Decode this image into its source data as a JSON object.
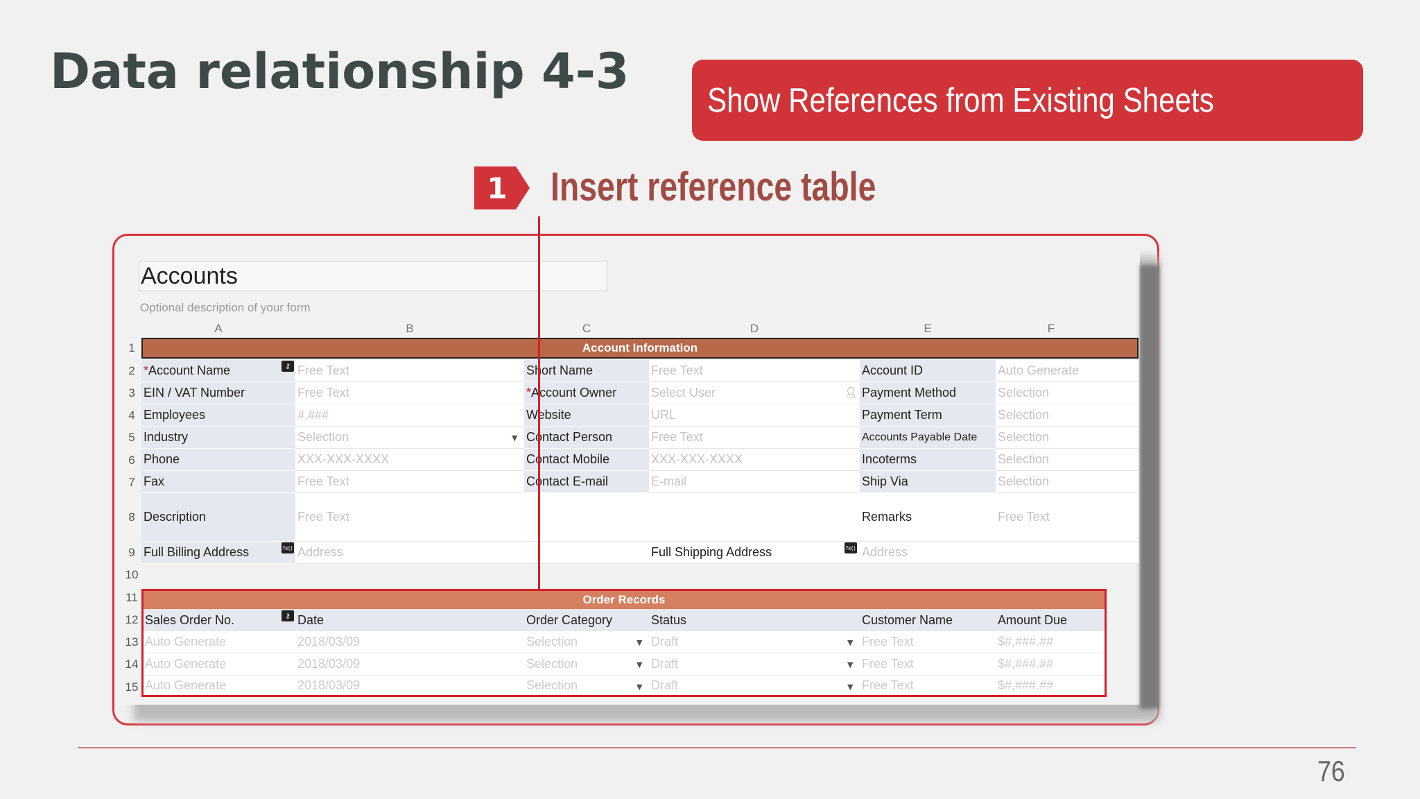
{
  "slide": {
    "title": "Data relationship 4-3",
    "banner": "Show References from Existing Sheets",
    "step_number": "1",
    "step_label": "Insert reference table",
    "page_number": "76"
  },
  "colors": {
    "accent_red": "#d13438",
    "section_header": "#b8694a",
    "label_bg": "#e5e8ee"
  },
  "form": {
    "title": "Accounts",
    "description": "Optional description of your form",
    "columns": [
      "A",
      "B",
      "C",
      "D",
      "E",
      "F"
    ],
    "rows": [
      "1",
      "2",
      "3",
      "4",
      "5",
      "6",
      "7",
      "8",
      "9",
      "10",
      "11",
      "12",
      "13",
      "14",
      "15"
    ],
    "account_section": "Account Information",
    "fields": {
      "account_name": "Account Name",
      "ein": "EIN / VAT Number",
      "employees": "Employees",
      "industry": "Industry",
      "phone": "Phone",
      "fax": "Fax",
      "description": "Description",
      "billing": "Full Billing Address",
      "short_name": "Short Name",
      "account_owner": "Account Owner",
      "website": "Website",
      "contact_person": "Contact Person",
      "contact_mobile": "Contact Mobile",
      "contact_email": "Contact E-mail",
      "shipping": "Full Shipping Address",
      "account_id": "Account ID",
      "payment_method": "Payment Method",
      "payment_term": "Payment Term",
      "payable_date": "Accounts Payable Date",
      "incoterms": "Incoterms",
      "ship_via": "Ship Via",
      "remarks": "Remarks"
    },
    "placeholders": {
      "free_text": "Free Text",
      "number": "#,###",
      "selection": "Selection",
      "phone": "XXX-XXX-XXXX",
      "select_user": "Select User",
      "url": "URL",
      "email": "E-mail",
      "auto_generate": "Auto Generate",
      "address": "Address"
    },
    "required_mark": "*",
    "icons": {
      "key": "⚷",
      "fx": "fx()"
    }
  },
  "order_records": {
    "title": "Order Records",
    "headers": [
      "Sales Order No.",
      "Date",
      "Order Category",
      "Status",
      "Customer Name",
      "Amount Due"
    ],
    "rows": [
      [
        "Auto Generate",
        "2018/03/09",
        "Selection",
        "Draft",
        "Free Text",
        "$#,###.##"
      ],
      [
        "Auto Generate",
        "2018/03/09",
        "Selection",
        "Draft",
        "Free Text",
        "$#,###.##"
      ],
      [
        "Auto Generate",
        "2018/03/09",
        "Selection",
        "Draft",
        "Free Text",
        "$#,###.##"
      ]
    ]
  }
}
